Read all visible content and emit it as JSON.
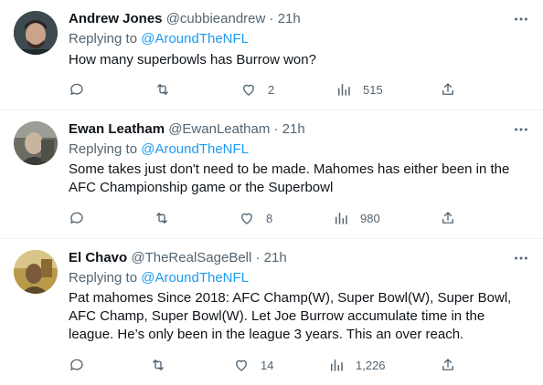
{
  "tweets": [
    {
      "name": "Andrew Jones",
      "handle": "@cubbieandrew",
      "time": "21h",
      "replying_prefix": "Replying to",
      "replying_to": "@AroundTheNFL",
      "text": "How many superbowls has Burrow won?",
      "likes": "2",
      "views": "515",
      "avatar_colors": [
        "#2b3a3f",
        "#c9a48a"
      ]
    },
    {
      "name": "Ewan Leatham",
      "handle": "@EwanLeatham",
      "time": "21h",
      "replying_prefix": "Replying to",
      "replying_to": "@AroundTheNFL",
      "text": "Some takes just don't need to be made.  Mahomes has either been in the AFC Championship game or the Superbowl",
      "likes": "8",
      "views": "980",
      "avatar_colors": [
        "#5a5a55",
        "#b8b0a0"
      ]
    },
    {
      "name": "El Chavo",
      "handle": "@TheRealSageBell",
      "time": "21h",
      "replying_prefix": "Replying to",
      "replying_to": "@AroundTheNFL",
      "text": "Pat mahomes Since 2018: AFC Champ(W), Super Bowl(W), Super Bowl, AFC Champ, Super Bowl(W).  Let Joe Burrow accumulate time in the league. He’s only been in the league 3 years. This an over reach.",
      "likes": "14",
      "views": "1,226",
      "avatar_colors": [
        "#8a7a3a",
        "#d8c27a"
      ]
    }
  ],
  "icons": [
    "reply-icon",
    "retweet-icon",
    "like-icon",
    "views-icon",
    "share-icon",
    "more-icon"
  ],
  "colors": {
    "text": "#0f1419",
    "secondary": "#536471",
    "accent": "#1d9bf0",
    "divider": "#eff3f4"
  }
}
